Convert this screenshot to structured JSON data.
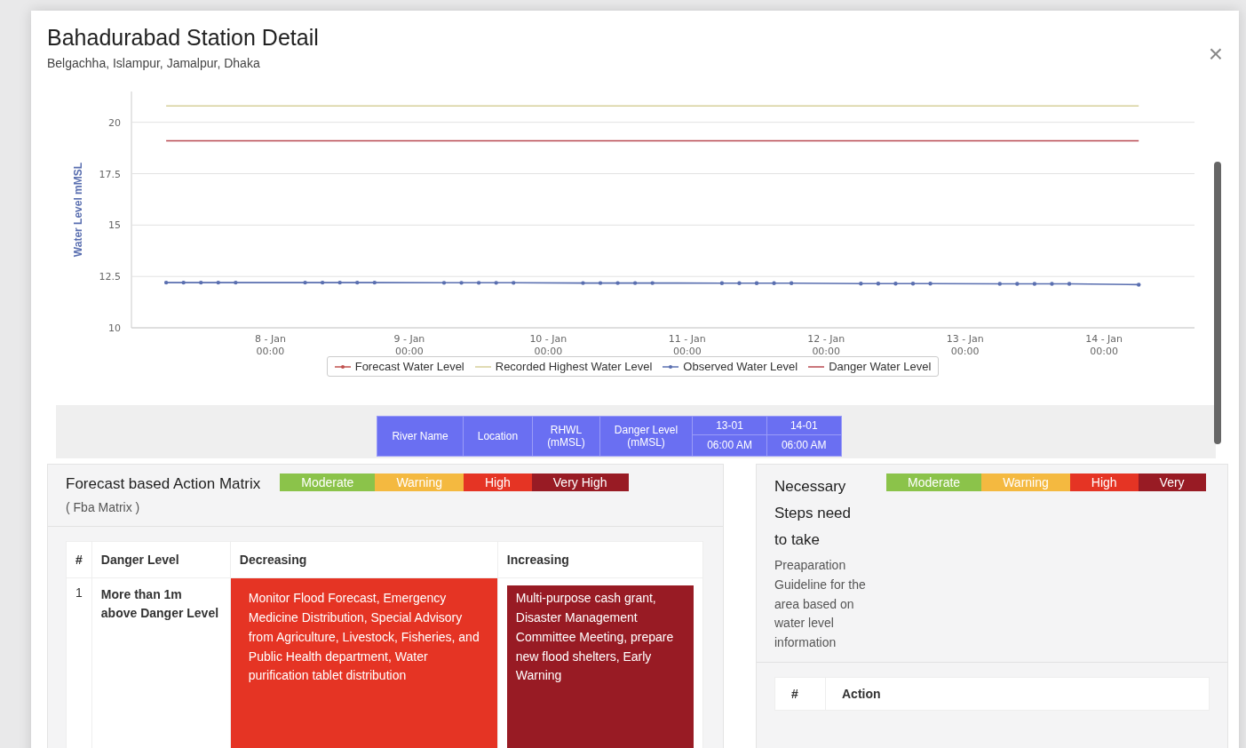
{
  "modal": {
    "title": "Bahadurabad Station Detail",
    "subtitle": "Belgachha, Islampur, Jamalpur, Dhaka",
    "close": "×"
  },
  "chart": {
    "chart_data": {
      "type": "line",
      "grid": true,
      "legend": "bottom",
      "ylabel": "Water Level mMSL",
      "ylim": [
        10,
        21.5
      ],
      "yticks": [
        10,
        12.5,
        15,
        17.5,
        20
      ],
      "categories": [
        null,
        null,
        null,
        null,
        null,
        null,
        null,
        null,
        "8 - Jan\n00:00",
        null,
        null,
        null,
        null,
        null,
        null,
        null,
        "9 - Jan\n00:00",
        null,
        null,
        null,
        null,
        null,
        null,
        null,
        "10 - Jan\n00:00",
        null,
        null,
        null,
        null,
        null,
        null,
        null,
        "11 - Jan\n00:00",
        null,
        null,
        null,
        null,
        null,
        null,
        null,
        "12 - Jan\n00:00",
        null,
        null,
        null,
        null,
        null,
        null,
        null,
        "13 - Jan\n00:00",
        null,
        null,
        null,
        null,
        null,
        null,
        null,
        "14 - Jan\n00:00",
        null,
        null
      ],
      "series": [
        {
          "name": "Forecast Water Level",
          "color": "#c0504d",
          "values": [
            null,
            null,
            null,
            null,
            null,
            null,
            null,
            null,
            null,
            null,
            null,
            null,
            null,
            null,
            null,
            null,
            null,
            null,
            null,
            null,
            null,
            null,
            null,
            null,
            null,
            null,
            null,
            null,
            null,
            null,
            null,
            null,
            null,
            null,
            null,
            null,
            null,
            null,
            null,
            null,
            null,
            null,
            null,
            null,
            null,
            null,
            null,
            null,
            null,
            null,
            null,
            null,
            null,
            null,
            null,
            null,
            null,
            null,
            null
          ]
        },
        {
          "name": "Recorded Highest Water Level",
          "color": "#d6cf9a",
          "values": [
            null,
            null,
            20.8,
            20.8,
            20.8,
            20.8,
            20.8,
            20.8,
            20.8,
            20.8,
            20.8,
            20.8,
            20.8,
            20.8,
            20.8,
            20.8,
            20.8,
            20.8,
            20.8,
            20.8,
            20.8,
            20.8,
            20.8,
            20.8,
            20.8,
            20.8,
            20.8,
            20.8,
            20.8,
            20.8,
            20.8,
            20.8,
            20.8,
            20.8,
            20.8,
            20.8,
            20.8,
            20.8,
            20.8,
            20.8,
            20.8,
            20.8,
            20.8,
            20.8,
            20.8,
            20.8,
            20.8,
            20.8,
            20.8,
            20.8,
            20.8,
            20.8,
            20.8,
            20.8,
            20.8,
            20.8,
            20.8,
            20.8,
            20.8
          ]
        },
        {
          "name": "Observed Water Level",
          "color": "#5a6fb0",
          "values": [
            null,
            null,
            12.2,
            12.2,
            12.2,
            12.2,
            12.2,
            null,
            null,
            null,
            12.2,
            12.2,
            12.2,
            12.2,
            12.2,
            null,
            null,
            null,
            12.19,
            12.19,
            12.19,
            12.19,
            12.19,
            null,
            null,
            null,
            12.18,
            12.18,
            12.18,
            12.18,
            12.18,
            null,
            null,
            null,
            12.17,
            12.17,
            12.17,
            12.17,
            12.17,
            null,
            null,
            null,
            12.15,
            12.15,
            12.15,
            12.15,
            12.15,
            null,
            null,
            null,
            12.14,
            12.14,
            12.14,
            12.14,
            12.14,
            null,
            null,
            null,
            12.1
          ]
        },
        {
          "name": "Danger Water Level",
          "color": "#b8484f",
          "values": [
            null,
            null,
            19.1,
            19.1,
            19.1,
            19.1,
            19.1,
            19.1,
            19.1,
            19.1,
            19.1,
            19.1,
            19.1,
            19.1,
            19.1,
            19.1,
            19.1,
            19.1,
            19.1,
            19.1,
            19.1,
            19.1,
            19.1,
            19.1,
            19.1,
            19.1,
            19.1,
            19.1,
            19.1,
            19.1,
            19.1,
            19.1,
            19.1,
            19.1,
            19.1,
            19.1,
            19.1,
            19.1,
            19.1,
            19.1,
            19.1,
            19.1,
            19.1,
            19.1,
            19.1,
            19.1,
            19.1,
            19.1,
            19.1,
            19.1,
            19.1,
            19.1,
            19.1,
            19.1,
            19.1,
            19.1,
            19.1,
            19.1,
            19.1
          ]
        }
      ]
    }
  },
  "station_table": {
    "columns": [
      {
        "label": "River Name",
        "kind": "static"
      },
      {
        "label": "Location",
        "kind": "static"
      },
      {
        "label": "RHWL",
        "sub": "(mMSL)",
        "kind": "static"
      },
      {
        "label": "Danger Level",
        "sub": "(mMSL)",
        "kind": "static"
      },
      {
        "label": "13-01",
        "sub": "06:00 AM",
        "kind": "forecast"
      },
      {
        "label": "14-01",
        "sub": "06:00 AM",
        "kind": "forecast"
      }
    ]
  },
  "fba": {
    "title": "Forecast based Action Matrix",
    "subtitle": "( Fba Matrix )",
    "legend": [
      {
        "label": "Moderate",
        "color": "#8bc34a"
      },
      {
        "label": "Warning",
        "color": "#f4b940"
      },
      {
        "label": "High",
        "color": "#e53424"
      },
      {
        "label": "Very High",
        "color": "#981b24"
      }
    ],
    "columns": [
      "#",
      "Danger Level",
      "Decreasing",
      "Increasing"
    ],
    "rows": [
      {
        "index": "1",
        "danger_level": "More than 1m above Danger Level",
        "decreasing": {
          "text": "Monitor Flood Forecast, Emergency Medicine Distribution, Special Advisory from Agriculture, Livestock, Fisheries, and Public Health department, Water purification tablet distribution",
          "color": "#e53424"
        },
        "increasing": {
          "text": "Multi-purpose cash grant, Disaster Management Committee Meeting, prepare new flood shelters, Early Warning",
          "color": "#981b24"
        }
      }
    ]
  },
  "steps": {
    "title": "Necessary Steps need to take",
    "subtitle": "Preaparation Guideline for the area based on water level information",
    "legend": [
      {
        "label": "Moderate",
        "color": "#8bc34a"
      },
      {
        "label": "Warning",
        "color": "#f4b940"
      },
      {
        "label": "High",
        "color": "#e53424"
      },
      {
        "label": "Very",
        "color": "#981b24"
      }
    ],
    "columns": [
      "#",
      "Action"
    ]
  }
}
